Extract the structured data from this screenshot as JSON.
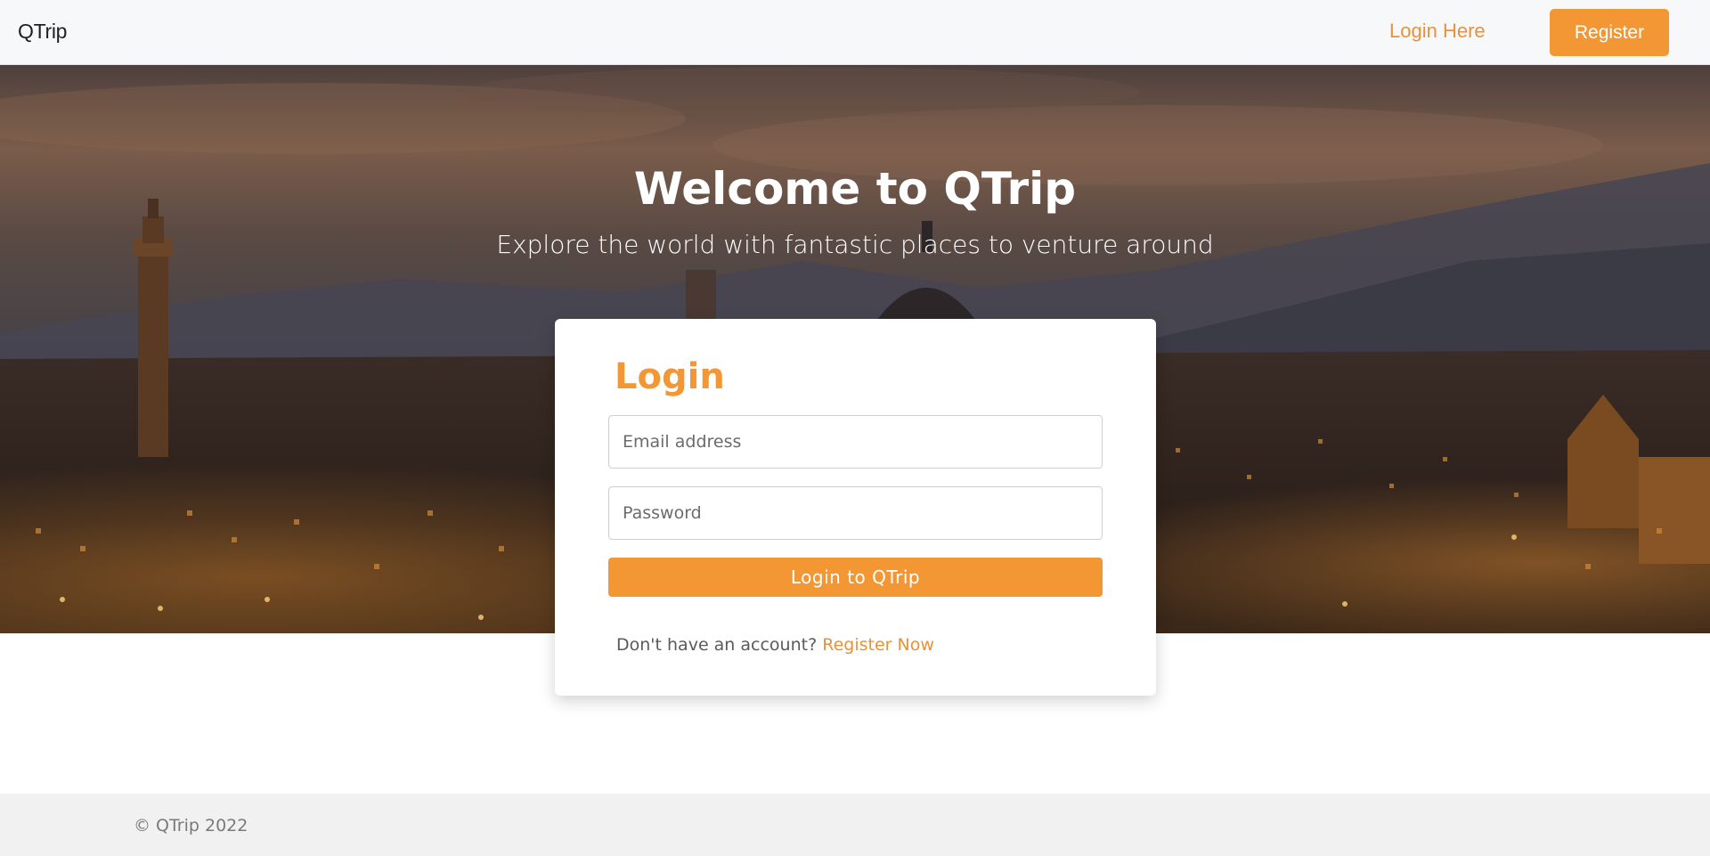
{
  "navbar": {
    "brand": "QTrip",
    "login_link": "Login Here",
    "register_button": "Register"
  },
  "hero": {
    "title": "Welcome to QTrip",
    "subtitle": "Explore the world with fantastic places to venture around"
  },
  "login_card": {
    "title": "Login",
    "email_placeholder": "Email address",
    "email_value": "",
    "password_placeholder": "Password",
    "password_value": "",
    "submit_label": "Login to QTrip",
    "signup_prompt": "Don't have an account?",
    "signup_link": "Register Now"
  },
  "footer": {
    "copyright": "© QTrip 2022"
  },
  "colors": {
    "accent": "#f29734",
    "link": "#e8913a",
    "navbar_bg": "#f7f8fa",
    "footer_bg": "#f1f1f1"
  }
}
